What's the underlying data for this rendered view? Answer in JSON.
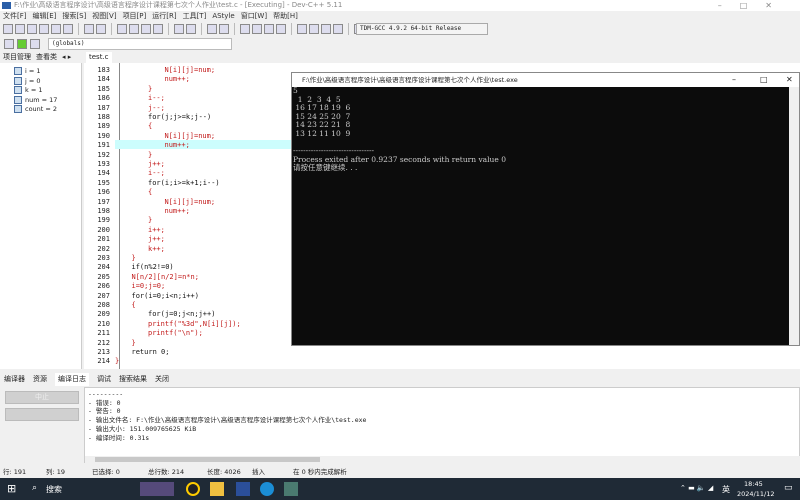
{
  "window": {
    "title": "F:\\作业\\高级语言程序设计\\高级语言程序设计课程第七次个人作业\\test.c - [Executing] - Dev-C++ 5.11"
  },
  "menu": [
    "文件[F]",
    "编辑[E]",
    "搜索[S]",
    "视图[V]",
    "项目[P]",
    "运行[R]",
    "工具[T]",
    "AStyle",
    "窗口[W]",
    "帮助[H]"
  ],
  "toolbar": {
    "compiler": "TDM-GCC 4.9.2 64-bit Release",
    "scope": "(globals)"
  },
  "left_panel": {
    "tabs": [
      "项目管理",
      "查看类"
    ],
    "variables": [
      "i = 1",
      "j = 0",
      "k = 1",
      "num = 17",
      "count = 2"
    ]
  },
  "editor": {
    "tab": "test.c",
    "current_line": 191,
    "lines": [
      {
        "n": 183,
        "l": 3,
        "t": "N[i][j]=num;"
      },
      {
        "n": 184,
        "l": 3,
        "t": "num++;"
      },
      {
        "n": 185,
        "l": 2,
        "t": "}"
      },
      {
        "n": 186,
        "l": 2,
        "t": "i--;"
      },
      {
        "n": 187,
        "l": 2,
        "t": "j--;"
      },
      {
        "n": 188,
        "l": 2,
        "t": "for(j;j>=k;j--)"
      },
      {
        "n": 189,
        "l": 2,
        "t": "{"
      },
      {
        "n": 190,
        "l": 3,
        "t": "N[i][j]=num;"
      },
      {
        "n": 191,
        "l": 3,
        "t": "num++;"
      },
      {
        "n": 192,
        "l": 2,
        "t": "}"
      },
      {
        "n": 193,
        "l": 2,
        "t": "j++;"
      },
      {
        "n": 194,
        "l": 2,
        "t": "i--;"
      },
      {
        "n": 195,
        "l": 2,
        "t": "for(i;i>=k+1;i--)"
      },
      {
        "n": 196,
        "l": 2,
        "t": "{"
      },
      {
        "n": 197,
        "l": 3,
        "t": "N[i][j]=num;"
      },
      {
        "n": 198,
        "l": 3,
        "t": "num++;"
      },
      {
        "n": 199,
        "l": 2,
        "t": "}"
      },
      {
        "n": 200,
        "l": 2,
        "t": "i++;"
      },
      {
        "n": 201,
        "l": 2,
        "t": "j++;"
      },
      {
        "n": 202,
        "l": 2,
        "t": "k++;"
      },
      {
        "n": 203,
        "l": 1,
        "t": "}"
      },
      {
        "n": 204,
        "l": 1,
        "t": "if(n%2!=0)"
      },
      {
        "n": 205,
        "l": 1,
        "t": "N[n/2][n/2]=n*n;"
      },
      {
        "n": 206,
        "l": 1,
        "t": "i=0;j=0;"
      },
      {
        "n": 207,
        "l": 1,
        "t": "for(i=0;i<n;i++)"
      },
      {
        "n": 208,
        "l": 1,
        "t": "{"
      },
      {
        "n": 209,
        "l": 2,
        "t": "for(j=0;j<n;j++)"
      },
      {
        "n": 210,
        "l": 2,
        "t": "printf(\"%3d\",N[i][j]);"
      },
      {
        "n": 211,
        "l": 2,
        "t": "printf(\"\\n\");"
      },
      {
        "n": 212,
        "l": 1,
        "t": "}"
      },
      {
        "n": 213,
        "l": 1,
        "t": "return 0;"
      },
      {
        "n": 214,
        "l": 0,
        "t": "}"
      }
    ]
  },
  "console": {
    "title": "F:\\作业\\高级语言程序设计\\高级语言程序设计课程第七次个人作业\\test.exe",
    "output": "5\n  1  2  3  4  5\n 16 17 18 19  6\n 15 24 25 20  7\n 14 23 22 21  8\n 13 12 11 10  9\n\n--------------------------------\nProcess exited after 0.9237 seconds with return value 0\n请按任意键继续. . ."
  },
  "bottom_tabs": [
    "编译器",
    "资源",
    "编译日志",
    "调试",
    "搜索结果",
    "关闭"
  ],
  "log": {
    "abort_label": "中止",
    "text": "---------\n- 错误: 0\n- 警告: 0\n- 输出文件名: F:\\作业\\高级语言程序设计\\高级语言程序设计课程第七次个人作业\\test.exe\n- 输出大小: 151.009765625 KiB\n- 编译时间: 0.31s"
  },
  "status": {
    "row": "行: 191",
    "col": "列: 19",
    "selected": "已选择: 0",
    "total": "总行数: 214",
    "length": "长度: 4026",
    "mode": "插入",
    "parse": "在 0 秒内完成解析"
  },
  "taskbar": {
    "search": "搜索",
    "ime": "英",
    "time": "18:45",
    "date": "2024/11/12"
  }
}
